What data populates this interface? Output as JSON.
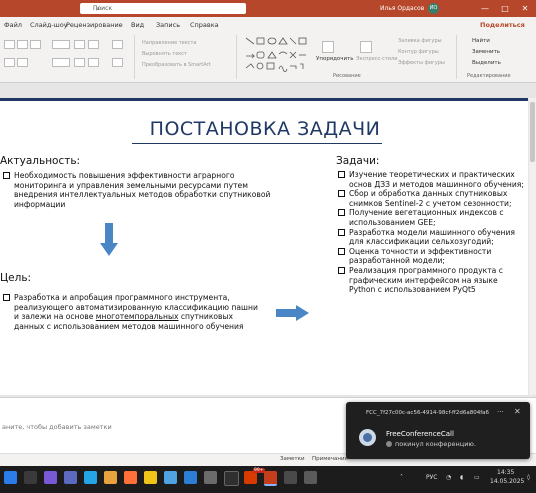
{
  "titlebar": {
    "search_placeholder": "Поиск",
    "user_name": "Илья Ордасов",
    "user_initials": "ИО",
    "controls": [
      "—",
      "□",
      "✕"
    ]
  },
  "menu": {
    "items": [
      "Файл",
      "Слайд-шоу",
      "Рецензирование",
      "Вид",
      "Запись",
      "Справка"
    ],
    "share_label": "Поделиться"
  },
  "ribbon": {
    "paragraph": {
      "direction": "Направление текста",
      "align": "Выровнять текст",
      "smartart": "Преобразовать в SmartArt"
    },
    "drawing": {
      "arrange": "Упорядочить",
      "quick_styles": "Экспресс-стили",
      "fill": "Заливка фигуры",
      "outline": "Контур фигуры",
      "effects": "Эффекты фигуры",
      "label": "Рисование"
    },
    "editing": {
      "find": "Найти",
      "replace": "Заменить",
      "select": "Выделить",
      "label": "Редактирование"
    }
  },
  "slide": {
    "title": "ПОСТАНОВКА ЗАДАЧИ",
    "relevance_header": "Актуальность:",
    "relevance_text": "Необходимость повышения эффективности аграрного мониторинга и управления земельными ресурсами путем внедрения интеллектуальных методов обработки спутниковой информации",
    "goal_header": "Цель:",
    "goal_text_1": "Разработка и апробация программного инструмента, реализующего автоматизированную классификацию пашни и залежи на основе ",
    "goal_text_link": "многотемпоральных",
    "goal_text_2": " спутниковых данных с использованием методов машинного обучения",
    "tasks_header": "Задачи:",
    "tasks": [
      "Изучение теоретических и практических основ ДЗЗ и методов машинного обучения;",
      "Сбор и обработка данных спутниковых снимков Sentinel-2 с учетом сезонности;",
      "Получение вегетационных индексов с использованием GEE;",
      "Разработка модели машинного обучения для классификации сельхозугодий;",
      "Оценка точности и эффективности разработанной модели;",
      "Реализация программного продукта с графическим интерфейсом на языке Python с использованием PyQt5"
    ]
  },
  "notes": {
    "placeholder": "аните, чтобы добавить заметки"
  },
  "statusbar": {
    "notes_btn": "Заметки",
    "comments_btn": "Примечания"
  },
  "toast": {
    "header": "FCC_7f27c00c-ac56-4914-98cf-ff2d6a804fa6",
    "more": "···",
    "close": "✕",
    "app": "FreeConferenceCall",
    "message": "покинул конференцию."
  },
  "taskbar": {
    "badge": "99+",
    "lang": "РУС",
    "time": "14:35",
    "date": "14.05.2025"
  },
  "colors": {
    "accent": "#b7472a",
    "slide_navy": "#1f3864",
    "arrow": "#4a86c5"
  }
}
